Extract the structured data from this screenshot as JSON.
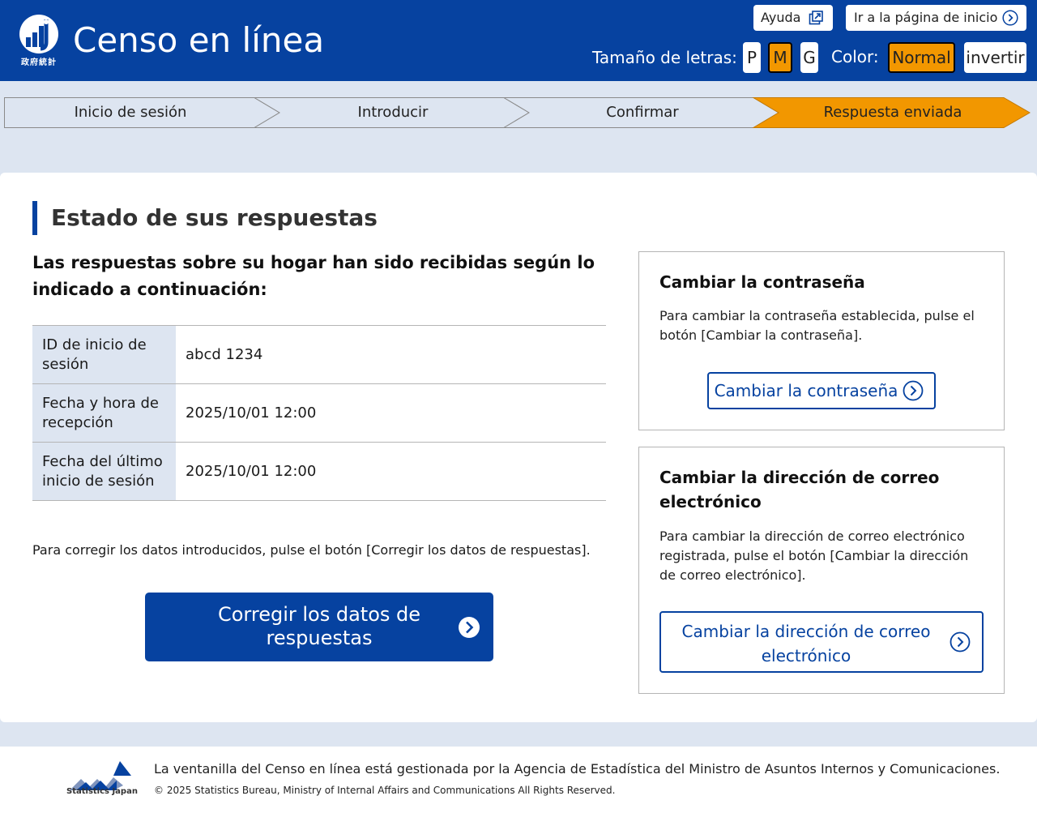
{
  "header": {
    "logo_caption": "政府統計",
    "title": "Censo en línea",
    "help_label": "Ayuda",
    "home_label": "Ir a la página de inicio",
    "font_size_label": "Tamaño de letras:",
    "font_sizes": [
      "P",
      "M",
      "G"
    ],
    "font_size_selected": "M",
    "color_label": "Color:",
    "color_normal": "Normal",
    "color_invert": "invertir",
    "color_selected": "Normal"
  },
  "steps": {
    "items": [
      "Inicio de sesión",
      "Introducir",
      "Confirmar",
      "Respuesta enviada"
    ],
    "current": "Respuesta enviada"
  },
  "main": {
    "section_title": "Estado de sus respuestas",
    "lead": "Las respuestas sobre su hogar han sido recibidas según lo indicado a continuación:",
    "table": [
      {
        "label": "ID de inicio de sesión",
        "value": "abcd 1234"
      },
      {
        "label": "Fecha y hora de recepción",
        "value": "2025/10/01 12:00"
      },
      {
        "label": "Fecha del último inicio de sesión",
        "value": "2025/10/01 12:00"
      }
    ],
    "fix_note": "Para corregir los datos introducidos, pulse el botón [Corregir los datos de respuestas].",
    "fix_button": "Corregir los datos de respuestas"
  },
  "password_box": {
    "title": "Cambiar la contraseña",
    "text": "Para cambiar la contraseña establecida, pulse el botón [Cambiar la contraseña].",
    "button": "Cambiar la contraseña"
  },
  "email_box": {
    "title": "Cambiar la dirección de correo electrónico",
    "text": "Para cambiar la dirección de correo electrónico registrada, pulse el botón [Cambiar la dirección de correo electrónico].",
    "button": "Cambiar la dirección de correo electrónico"
  },
  "footer": {
    "logo_text": "Statistics Japan",
    "line1": "La ventanilla del Censo en línea está gestionada por la Agencia de Estadística del Ministro de Asuntos Internos y Comunicaciones.",
    "line2": "© 2025 Statistics Bureau, Ministry of Internal Affairs and Communications All Rights Reserved."
  },
  "colors": {
    "primary": "#0642a0",
    "accent": "#f29700",
    "band": "#dde5f1"
  },
  "icons": [
    "logo-icon",
    "external-link-icon",
    "chevron-circle-right-icon",
    "statistics-japan-logo"
  ]
}
